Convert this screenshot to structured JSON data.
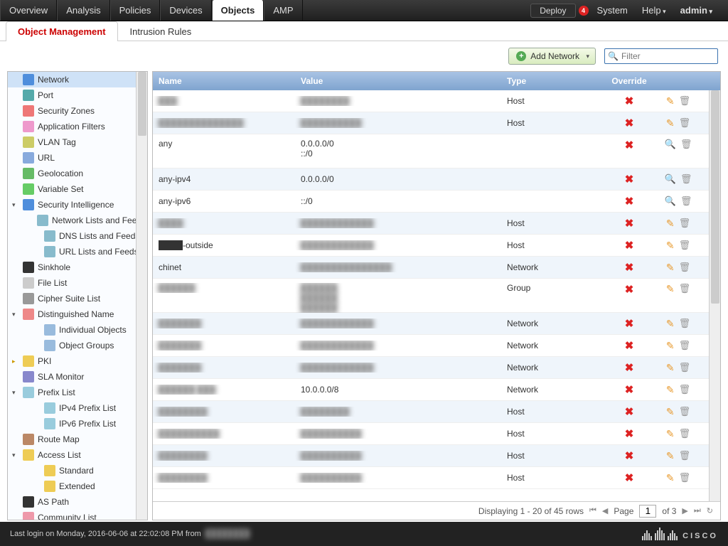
{
  "menubar": {
    "items": [
      "Overview",
      "Analysis",
      "Policies",
      "Devices",
      "Objects",
      "AMP"
    ],
    "active": 4,
    "deploy": "Deploy",
    "alert_count": "4",
    "system": "System",
    "help": "Help",
    "admin": "admin"
  },
  "subtabs": {
    "items": [
      "Object Management",
      "Intrusion Rules"
    ],
    "active": 0
  },
  "toolbar": {
    "add_label": "Add Network",
    "filter_placeholder": "Filter"
  },
  "sidebar": {
    "items": [
      {
        "label": "Network",
        "icon": "net",
        "sel": true,
        "tri": ""
      },
      {
        "label": "Port",
        "icon": "port"
      },
      {
        "label": "Security Zones",
        "icon": "zone"
      },
      {
        "label": "Application Filters",
        "icon": "appf"
      },
      {
        "label": "VLAN Tag",
        "icon": "vlan"
      },
      {
        "label": "URL",
        "icon": "url"
      },
      {
        "label": "Geolocation",
        "icon": "geo"
      },
      {
        "label": "Variable Set",
        "icon": "var"
      },
      {
        "label": "Security Intelligence",
        "icon": "si",
        "tri": "▾"
      },
      {
        "label": "Network Lists and Feeds",
        "icon": "feed",
        "indent": 2
      },
      {
        "label": "DNS Lists and Feeds",
        "icon": "feed",
        "indent": 2
      },
      {
        "label": "URL Lists and Feeds",
        "icon": "feed",
        "indent": 2
      },
      {
        "label": "Sinkhole",
        "icon": "sink"
      },
      {
        "label": "File List",
        "icon": "file"
      },
      {
        "label": "Cipher Suite List",
        "icon": "cipher"
      },
      {
        "label": "Distinguished Name",
        "icon": "dn",
        "tri": "▾"
      },
      {
        "label": "Individual Objects",
        "icon": "obj",
        "indent": 2
      },
      {
        "label": "Object Groups",
        "icon": "objg",
        "indent": 2
      },
      {
        "label": "PKI",
        "icon": "pki",
        "tri": "▸",
        "yellow": true
      },
      {
        "label": "SLA Monitor",
        "icon": "sla"
      },
      {
        "label": "Prefix List",
        "icon": "pfx",
        "tri": "▾"
      },
      {
        "label": "IPv4 Prefix List",
        "icon": "pfx4",
        "indent": 2
      },
      {
        "label": "IPv6 Prefix List",
        "icon": "pfx6",
        "indent": 2
      },
      {
        "label": "Route Map",
        "icon": "route"
      },
      {
        "label": "Access List",
        "icon": "acl",
        "tri": "▾"
      },
      {
        "label": "Standard",
        "icon": "acl",
        "indent": 2
      },
      {
        "label": "Extended",
        "icon": "acl",
        "indent": 2
      },
      {
        "label": "AS Path",
        "icon": "as"
      },
      {
        "label": "Community List",
        "icon": "comm"
      }
    ]
  },
  "grid": {
    "headers": {
      "name": "Name",
      "value": "Value",
      "type": "Type",
      "override": "Override"
    },
    "rows": [
      {
        "name": "███",
        "value": "████████",
        "type": "Host",
        "blur": true,
        "edit": "pencil"
      },
      {
        "name": "██████████████",
        "value": "██████████",
        "type": "Host",
        "blur": true,
        "edit": "pencil"
      },
      {
        "name": "any",
        "value": "0.0.0.0/0\n::/0",
        "type": "",
        "double": true,
        "edit": "mag"
      },
      {
        "name": "any-ipv4",
        "value": "0.0.0.0/0",
        "type": "",
        "edit": "mag"
      },
      {
        "name": "any-ipv6",
        "value": "::/0",
        "type": "",
        "edit": "mag"
      },
      {
        "name": "████",
        "value": "████████████",
        "type": "Host",
        "blur": true,
        "edit": "pencil"
      },
      {
        "name": "████-outside",
        "value": "████████████",
        "type": "Host",
        "blurval": true,
        "edit": "pencil"
      },
      {
        "name": "chinet",
        "value": "███████████████",
        "type": "Network",
        "blurval": true,
        "edit": "pencil"
      },
      {
        "name": "██████",
        "value": "██████\n██████\n██████",
        "type": "Group",
        "blur": true,
        "double": true,
        "edit": "pencil"
      },
      {
        "name": "███████",
        "value": "████████████",
        "type": "Network",
        "blur": true,
        "edit": "pencil"
      },
      {
        "name": "███████",
        "value": "████████████",
        "type": "Network",
        "blur": true,
        "edit": "pencil"
      },
      {
        "name": "███████",
        "value": "████████████",
        "type": "Network",
        "blur": true,
        "edit": "pencil"
      },
      {
        "name": "██████ ███",
        "value": "10.0.0.0/8",
        "type": "Network",
        "blurname": true,
        "edit": "pencil"
      },
      {
        "name": "████████",
        "value": "████████",
        "type": "Host",
        "blur": true,
        "edit": "pencil"
      },
      {
        "name": "██████████",
        "value": "██████████",
        "type": "Host",
        "blur": true,
        "edit": "pencil"
      },
      {
        "name": "████████",
        "value": "██████████",
        "type": "Host",
        "blur": true,
        "edit": "pencil"
      },
      {
        "name": "████████",
        "value": "██████████",
        "type": "Host",
        "blur": true,
        "edit": "pencil"
      }
    ],
    "pager": {
      "status": "Displaying 1 - 20 of 45 rows",
      "page": "1",
      "of_label": "of 3",
      "page_label": "Page"
    }
  },
  "footer": {
    "login": "Last login on Monday, 2016-06-06 at 22:02:08 PM from",
    "brand": "cisco"
  },
  "icon_colors": {
    "net": "#4f8edc",
    "port": "#5aa",
    "zone": "#e77",
    "appf": "#e9c",
    "vlan": "#cc6",
    "url": "#8ad",
    "geo": "#6b6",
    "var": "#6c6",
    "si": "#4f8edc",
    "feed": "#8bc",
    "sink": "#333",
    "file": "#ccc",
    "cipher": "#999",
    "dn": "#e88",
    "obj": "#9bd",
    "objg": "#9bd",
    "pki": "#ec5",
    "sla": "#88c",
    "pfx": "#9cd",
    "pfx4": "#9cd",
    "pfx6": "#9cd",
    "route": "#b86",
    "acl": "#ec5",
    "as": "#333",
    "comm": "#e9a"
  }
}
